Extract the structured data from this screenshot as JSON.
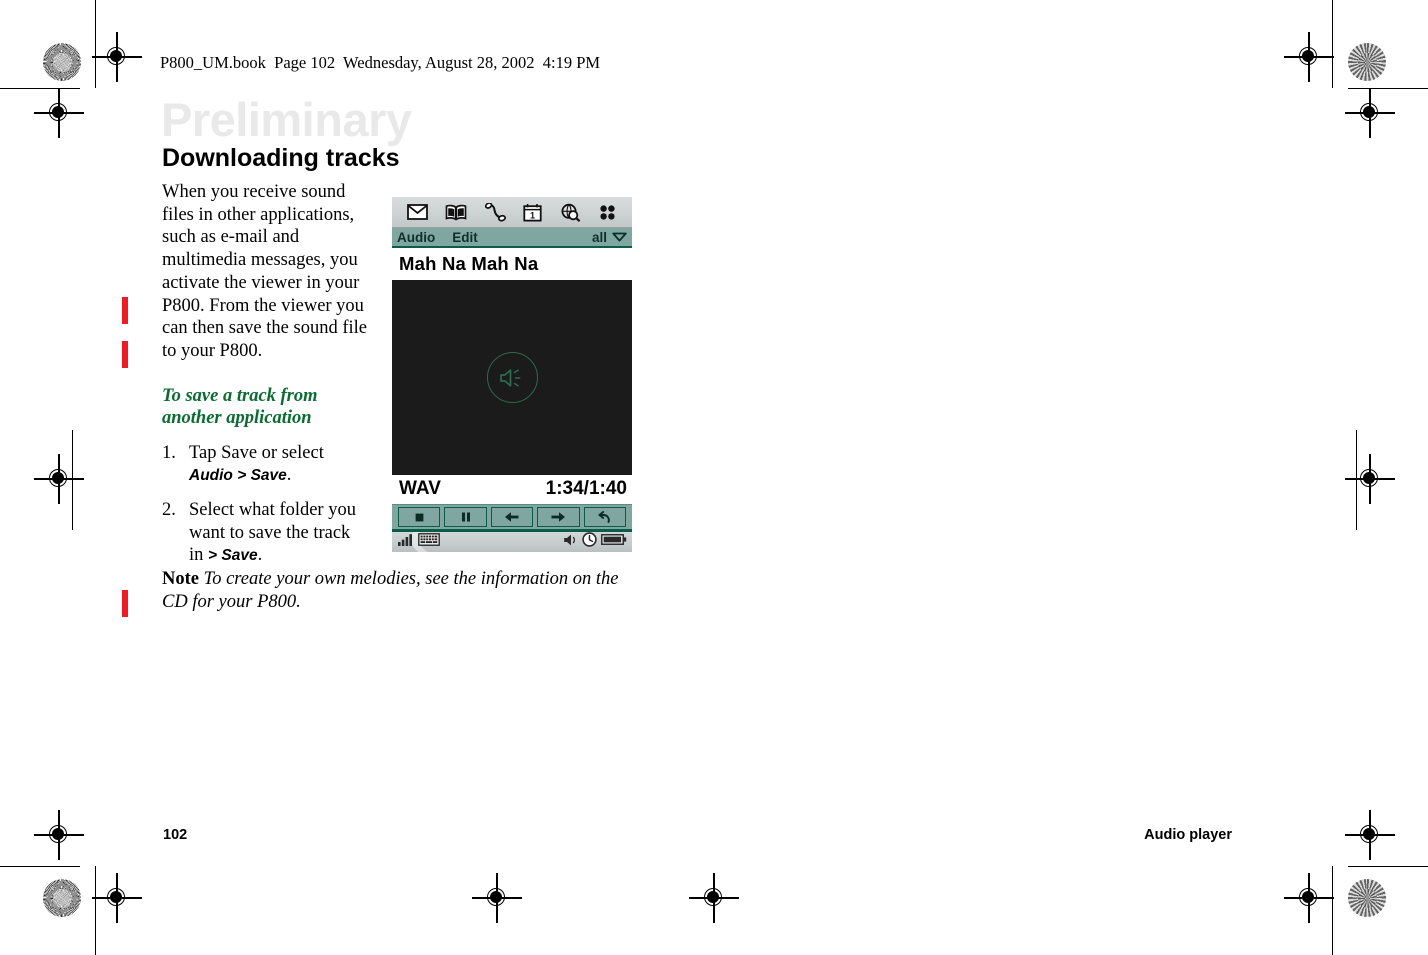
{
  "page_header": "P800_UM.book  Page 102  Wednesday, August 28, 2002  4:19 PM",
  "watermark": "Preliminary",
  "heading": "Downloading tracks",
  "body": {
    "intro": "When you receive sound files in other applications, such as e-mail and multimedia messages, you activate the viewer in your P800. From the viewer you can then save the sound file to your P800.",
    "sub_heading": "To save a track from another application",
    "steps": [
      {
        "num": "1.",
        "text_before": "Tap Save or select ",
        "ui_ref": "Audio > Save",
        "text_after": "."
      },
      {
        "num": "2.",
        "text_before": "Select what folder you want to save the track in ",
        "ui_ref": "> Save",
        "text_after": "."
      }
    ],
    "note_label": "Note",
    "note_text": " To create your own melodies, see the information on the CD for your P800."
  },
  "device": {
    "icon_bar": [
      {
        "name": "messaging-icon",
        "glyph": "envelope"
      },
      {
        "name": "contacts-icon",
        "glyph": "open-book"
      },
      {
        "name": "phone-icon",
        "glyph": "handset"
      },
      {
        "name": "calendar-icon",
        "glyph": "calendar-1"
      },
      {
        "name": "browser-icon",
        "glyph": "globe-magnifier"
      },
      {
        "name": "more-apps-icon",
        "glyph": "four-dots"
      }
    ],
    "menu_bar": {
      "items": [
        "Audio",
        "Edit"
      ],
      "filter_label": "all",
      "filter_icon": "chevron-down-icon"
    },
    "track_title": "Mah Na Mah Na",
    "viewer_icon": "speaker-icon",
    "format": "WAV",
    "time": "1:34/1:40",
    "controls": [
      {
        "name": "stop-button",
        "glyph": "stop"
      },
      {
        "name": "pause-button",
        "glyph": "pause"
      },
      {
        "name": "rewind-button",
        "glyph": "left-arrow"
      },
      {
        "name": "forward-button",
        "glyph": "right-arrow"
      },
      {
        "name": "back-button",
        "glyph": "return-arrow"
      }
    ],
    "status_bar": {
      "left": [
        "signal-icon",
        "keyboard-icon"
      ],
      "right": [
        "speaker-icon",
        "clock-icon",
        "battery-icon"
      ]
    }
  },
  "footer": {
    "page_number": "102",
    "chapter": "Audio player"
  },
  "colors": {
    "accent_green": "#0b6b31",
    "device_teal": "#7fa6a0",
    "device_dark_green": "#0d5c4a",
    "change_bar_red": "#ee1b24",
    "watermark_gray": "#e9e9e9"
  }
}
